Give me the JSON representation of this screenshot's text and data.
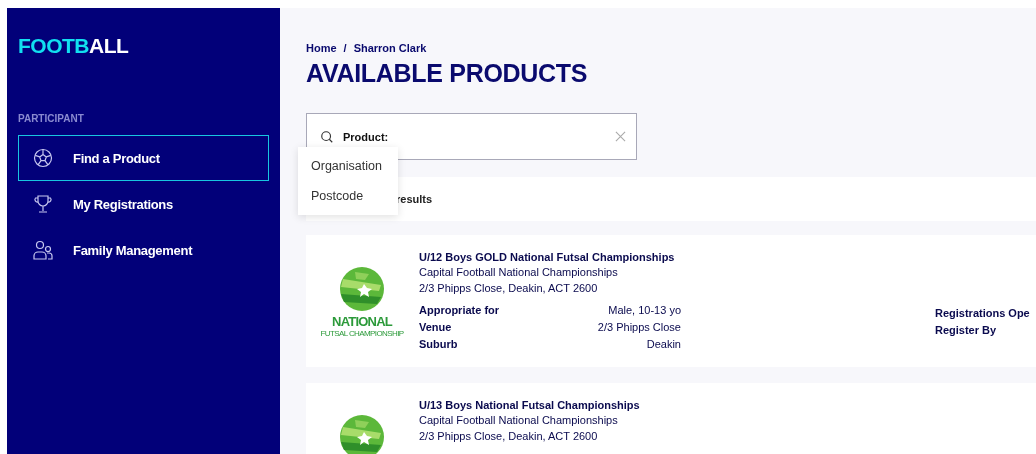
{
  "logo": {
    "accent": "FOOTB",
    "rest": "ALL"
  },
  "sidebar": {
    "section": "PARTICIPANT",
    "items": [
      {
        "label": "Find a Product",
        "selected": true
      },
      {
        "label": "My Registrations",
        "selected": false
      },
      {
        "label": "Family Management",
        "selected": false
      }
    ]
  },
  "breadcrumb": [
    "Home",
    "Sharron Clark"
  ],
  "breadcrumb_separator": "/",
  "title": "AVAILABLE PRODUCTS",
  "search": {
    "label": "Product:"
  },
  "dropdown": [
    "Organisation",
    "Postcode"
  ],
  "results_label": "results",
  "products": [
    {
      "title": "U/12 Boys GOLD National Futsal Championships",
      "organisation": "Capital Football National Championships",
      "address": "2/3 Phipps Close, Deakin, ACT 2600",
      "logo_text": [
        "NATIONAL",
        "FUTSAL CHAMPIONSHIP"
      ],
      "details": [
        {
          "label": "Appropriate for",
          "value": "Male, 10-13 yo"
        },
        {
          "label": "Venue",
          "value": "2/3 Phipps Close"
        },
        {
          "label": "Suburb",
          "value": "Deakin"
        }
      ],
      "side_labels": [
        "Registrations Ope",
        "Register By"
      ]
    },
    {
      "title": "U/13 Boys National Futsal Championships",
      "organisation": "Capital Football National Championships",
      "address": "2/3 Phipps Close, Deakin, ACT 2600"
    }
  ]
}
